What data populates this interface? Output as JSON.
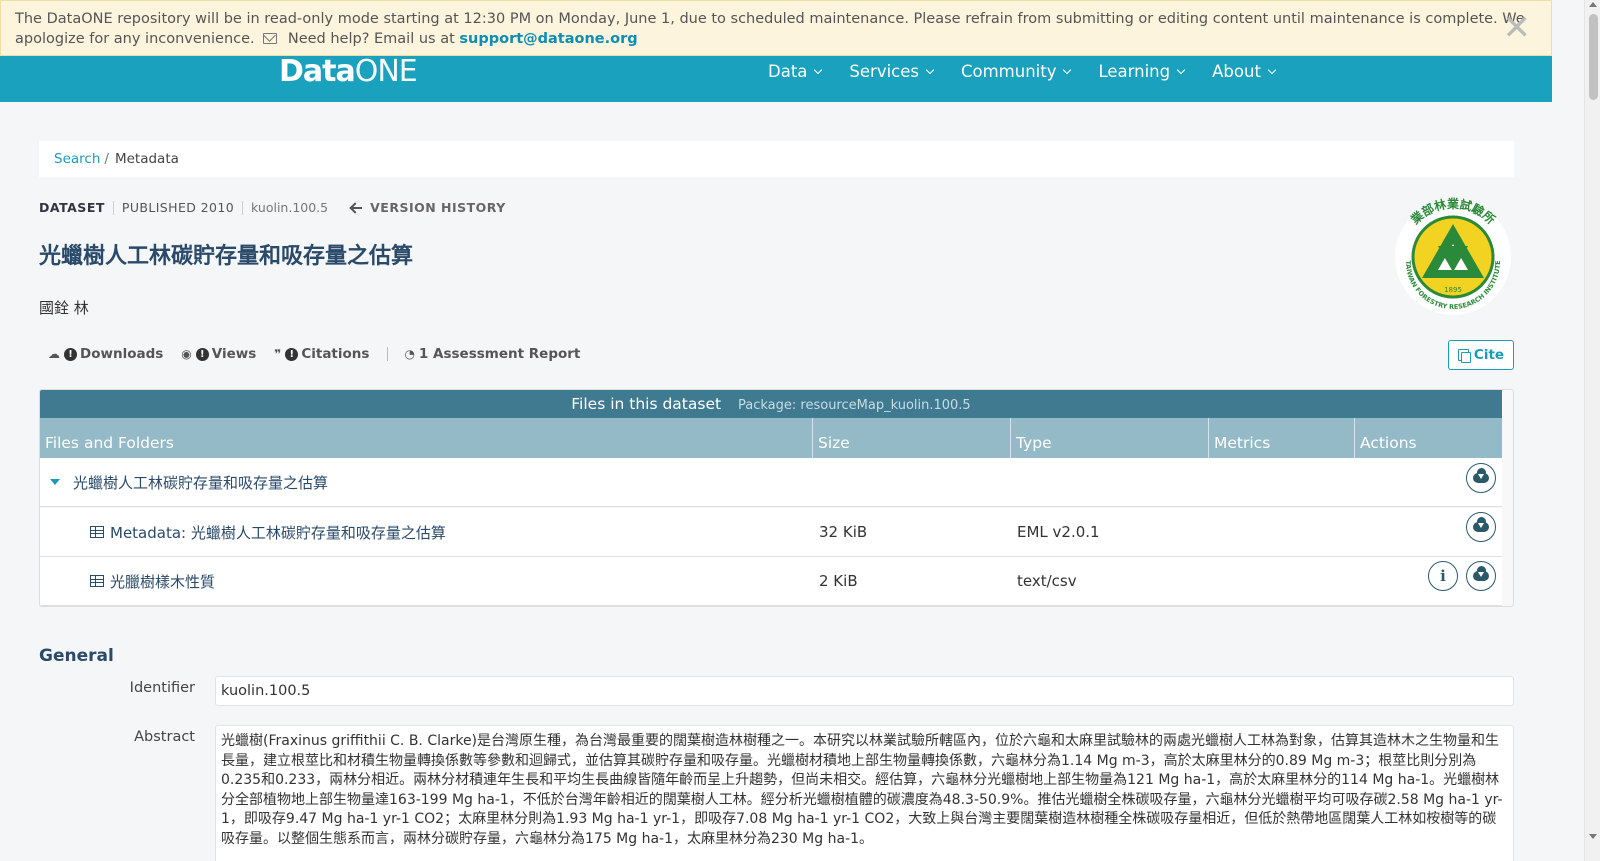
{
  "alert": {
    "message": "The DataONE repository will be in read-only mode starting at 12:30 PM on Monday, June 1, due to scheduled maintenance. Please refrain from submitting or editing content until maintenance is complete. We apologize for any inconvenience.",
    "help_text": "Need help? Email us at",
    "email": "support@dataone.org",
    "close_glyph": "✕"
  },
  "nav": {
    "logo_data": "Data",
    "logo_one": "ONE",
    "items": [
      "Data",
      "Services",
      "Community",
      "Learning",
      "About"
    ]
  },
  "breadcrumb": {
    "search": "Search",
    "separator": "/",
    "current": "Metadata"
  },
  "meta": {
    "type": "DATASET",
    "published": "PUBLISHED 2010",
    "identifier": "kuolin.100.5",
    "version_history": "VERSION HISTORY"
  },
  "title": "光蠟樹人工林碳貯存量和吸存量之估算",
  "author": "國銓 林",
  "institute_logo": {
    "top_text": "業部林業試驗所",
    "bottom_text": "TAIWAN FORESTRY RESEARCH INSTITUTE",
    "year": "1895"
  },
  "metrics": {
    "downloads": "Downloads",
    "views": "Views",
    "citations": "Citations",
    "assessment_count": "1",
    "assessment": "Assessment Report",
    "unknown_glyph": "!"
  },
  "cite_label": "Cite",
  "files": {
    "header": "Files in this dataset",
    "package": "Package: resourceMap_kuolin.100.5",
    "columns": [
      "Files and Folders",
      "Size",
      "Type",
      "Metrics",
      "Actions"
    ],
    "folder": "光蠟樹人工林碳貯存量和吸存量之估算",
    "rows": [
      {
        "name": "Metadata: 光蠟樹人工林碳貯存量和吸存量之估算",
        "size": "32 KiB",
        "type": "EML v2.0.1"
      },
      {
        "name": "光臘樹樣木性質",
        "size": "2 KiB",
        "type": "text/csv"
      }
    ],
    "info_glyph": "i"
  },
  "general": {
    "heading": "General",
    "identifier_label": "Identifier",
    "identifier_value": "kuolin.100.5",
    "abstract_label": "Abstract",
    "abstract": "光蠟樹(Fraxinus griffithii C. B. Clarke)是台灣原生種，為台灣最重要的闊葉樹造林樹種之一。本研究以林業試驗所轄區內，位於六龜和太麻里試驗林的兩處光蠟樹人工林為對象，估算其造林木之生物量和生長量，建立根莖比和材積生物量轉換係數等參數和迴歸式，並估算其碳貯存量和吸存量。光蠟樹材積地上部生物量轉換係數，六龜林分為1.14 Mg m-3，高於太麻里林分的0.89 Mg m-3；根莖比則分別為0.235和0.233，兩林分相近。兩林分材積連年生長和平均生長曲線皆隨年齡而呈上升趨勢，但尚未相交。經估算，六龜林分光蠟樹地上部生物量為121 Mg ha-1，高於太麻里林分的114 Mg ha-1。光蠟樹林分全部植物地上部生物量達163-199 Mg ha-1，不低於台灣年齡相近的闊葉樹人工林。經分析光蠟樹植體的碳濃度為48.3-50.9%。推估光蠟樹全株碳吸存量，六龜林分光蠟樹平均可吸存碳2.58 Mg ha-1 yr-1，即吸存9.47 Mg ha-1 yr-1 CO2；太麻里林分則為1.93 Mg ha-1 yr-1，即吸存7.08 Mg ha-1 yr-1 CO2，大致上與台灣主要闊葉樹造林樹種全株碳吸存量相近，但低於熱帶地區闊葉人工林如桉樹等的碳吸存量。以整個生態系而言，兩林分碳貯存量，六龜林分為175 Mg ha-1，太麻里林分為230 Mg ha-1。"
  }
}
